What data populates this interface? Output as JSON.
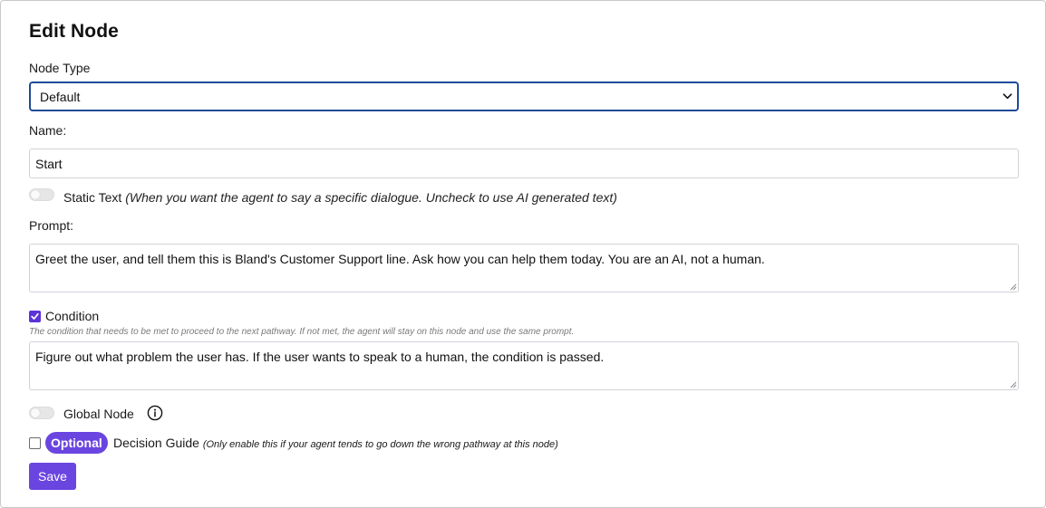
{
  "dialog": {
    "title": "Edit Node"
  },
  "node_type": {
    "label": "Node Type",
    "selected": "Default"
  },
  "name": {
    "label": "Name:",
    "value": "Start"
  },
  "static_text": {
    "enabled": false,
    "label": "Static Text",
    "hint": "(When you want the agent to say a specific dialogue. Uncheck to use AI generated text)"
  },
  "prompt": {
    "label": "Prompt:",
    "value": "Greet the user, and tell them this is Bland's Customer Support line. Ask how you can help them today. You are an AI, not a human."
  },
  "condition": {
    "checked": true,
    "label": "Condition",
    "help": "The condition that needs to be met to proceed to the next pathway. If not met, the agent will stay on this node and use the same prompt.",
    "value": "Figure out what problem the user has. If the user wants to speak to a human, the condition is passed."
  },
  "global_node": {
    "enabled": false,
    "label": "Global Node"
  },
  "decision_guide": {
    "checked": false,
    "badge": "Optional",
    "label": "Decision Guide",
    "hint": "(Only enable this if your agent tends to go down the wrong pathway at this node)"
  },
  "actions": {
    "save_label": "Save"
  },
  "colors": {
    "accent": "#6a45e0",
    "focus_border": "#1f4b99",
    "input_border": "#cfd3d8"
  }
}
